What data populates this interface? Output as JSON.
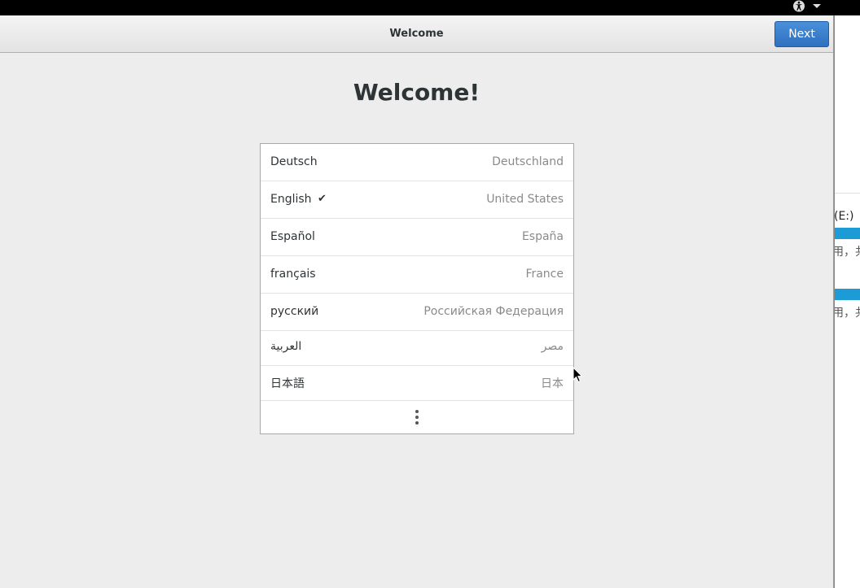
{
  "topbar": {
    "accessibility_icon": "accessibility-icon",
    "menu_icon": "triangle-down-icon"
  },
  "window": {
    "title": "Welcome",
    "next_label": "Next",
    "next_color": "#3b7fcf"
  },
  "main": {
    "heading": "Welcome!"
  },
  "languages": [
    {
      "name": "Deutsch",
      "region": "Deutschland",
      "selected": false
    },
    {
      "name": "English",
      "region": "United States",
      "selected": true
    },
    {
      "name": "Español",
      "region": "España",
      "selected": false
    },
    {
      "name": "français",
      "region": "France",
      "selected": false
    },
    {
      "name": "русский",
      "region": "Российская Федерация",
      "selected": false
    },
    {
      "name": "العربية",
      "region": "مصر",
      "selected": false
    },
    {
      "name": "日本語",
      "region": "日本",
      "selected": false
    }
  ],
  "check_glyph": "✔",
  "more_icon": "more-vertical-icon",
  "background_window": {
    "drive_label": "(E:)",
    "info_1": "用，共",
    "info_2": "用，共",
    "bar_color": "#1d9bd7"
  }
}
